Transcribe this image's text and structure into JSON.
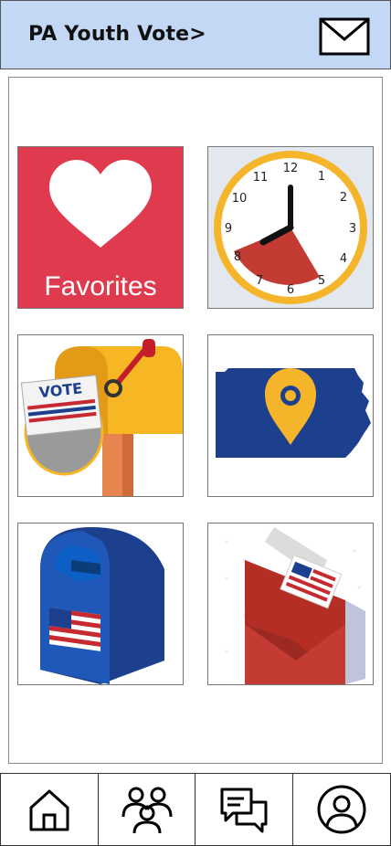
{
  "header": {
    "title": "PA Youth Vote>",
    "mail_icon": "mail-icon"
  },
  "tiles": {
    "favorites": {
      "label": "Favorites",
      "icon": "heart-icon",
      "color": "#e03a4e"
    },
    "clock": {
      "icon": "clock-icon",
      "numbers": [
        "12",
        "1",
        "2",
        "3",
        "4",
        "5",
        "6",
        "7",
        "8",
        "9",
        "10",
        "11"
      ],
      "ring_color": "#f4b52b"
    },
    "vote_mail": {
      "sign_text": "VOTE",
      "icon": "vote-mailbox-icon"
    },
    "pa_map": {
      "icon": "pennsylvania-map-pin-icon",
      "color": "#1c3f8e"
    },
    "blue_mailbox": {
      "icon": "usps-mailbox-icon"
    },
    "ballot_envelope": {
      "icon": "ballot-envelope-icon"
    }
  },
  "nav": [
    {
      "icon": "home-icon"
    },
    {
      "icon": "people-icon"
    },
    {
      "icon": "chat-icon"
    },
    {
      "icon": "profile-icon"
    }
  ]
}
